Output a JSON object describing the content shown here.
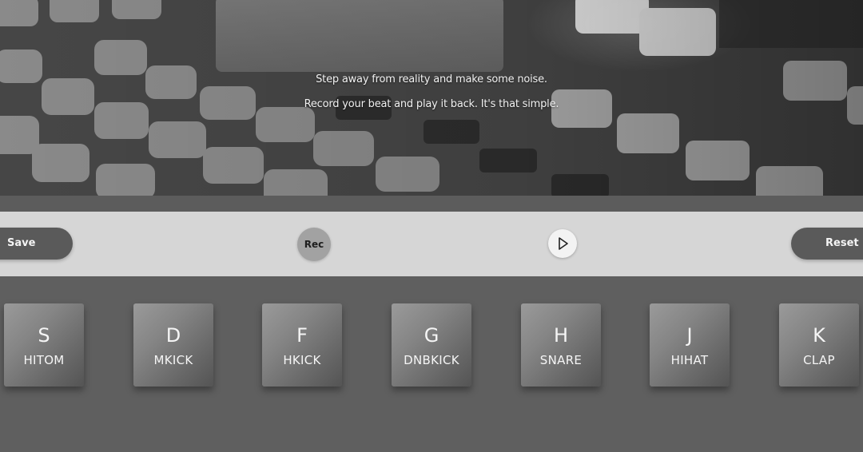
{
  "hero": {
    "line1": "Step away from reality and make some noise.",
    "line2": "Record your beat and play it back. It's that simple."
  },
  "controls": {
    "save_label": "Save",
    "rec_label": "Rec",
    "play_icon": "play-icon",
    "reset_label": "Reset"
  },
  "pads": [
    {
      "key": "S",
      "sound": "HITOM"
    },
    {
      "key": "D",
      "sound": "MKICK"
    },
    {
      "key": "F",
      "sound": "HKICK"
    },
    {
      "key": "G",
      "sound": "DNBKICK"
    },
    {
      "key": "H",
      "sound": "SNARE"
    },
    {
      "key": "J",
      "sound": "HIHAT"
    },
    {
      "key": "K",
      "sound": "CLAP"
    }
  ],
  "colors": {
    "page_background": "#5f5f5f",
    "controls_bar": "#d6d6d6",
    "pill_buttons": "#5a5a5a",
    "rec_button": "#a2a2a2",
    "play_button": "#f3f3f3"
  }
}
